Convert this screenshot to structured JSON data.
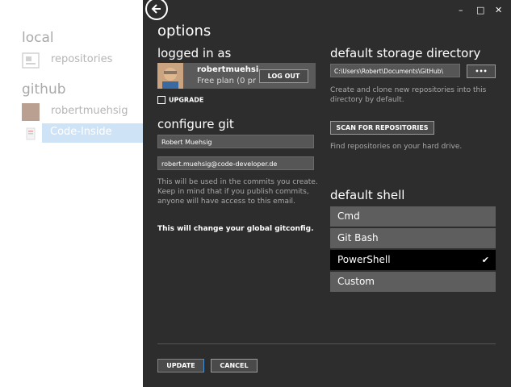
{
  "left_panel": {
    "local_heading": "local",
    "local_items": [
      {
        "label": "repositories"
      }
    ],
    "github_heading": "github",
    "github_items": [
      {
        "label": "robertmuehsig"
      },
      {
        "label": "Code-Inside"
      }
    ]
  },
  "header": {
    "title": "options"
  },
  "window_controls": {
    "minimize": "–",
    "maximize": "□",
    "close": "✕"
  },
  "account": {
    "heading": "logged in as",
    "username": "robertmuehsi",
    "plan": "Free plan (0 pr",
    "logout_label": "LOG OUT",
    "upgrade_label": "UPGRADE"
  },
  "git_config": {
    "heading": "configure git",
    "name_value": "Robert Muehsig",
    "email_value": "robert.muehsig@code-developer.de",
    "note": "This will be used in the commits you create. Keep in mind that if you publish commits, anyone will have access to this email.",
    "warning": "This will change your global gitconfig."
  },
  "storage": {
    "heading": "default storage directory",
    "path_value": "C:\\Users\\Robert\\Documents\\GitHub\\",
    "browse_label": "•••",
    "note": "Create and clone new repositories into this directory by default.",
    "scan_label": "SCAN FOR REPOSITORIES",
    "scan_note": "Find repositories on your hard drive."
  },
  "shell": {
    "heading": "default shell",
    "options": [
      {
        "label": "Cmd"
      },
      {
        "label": "Git Bash"
      },
      {
        "label": "PowerShell"
      },
      {
        "label": "Custom"
      }
    ],
    "selected": "PowerShell"
  },
  "footer": {
    "update_label": "UPDATE",
    "cancel_label": "CANCEL"
  }
}
